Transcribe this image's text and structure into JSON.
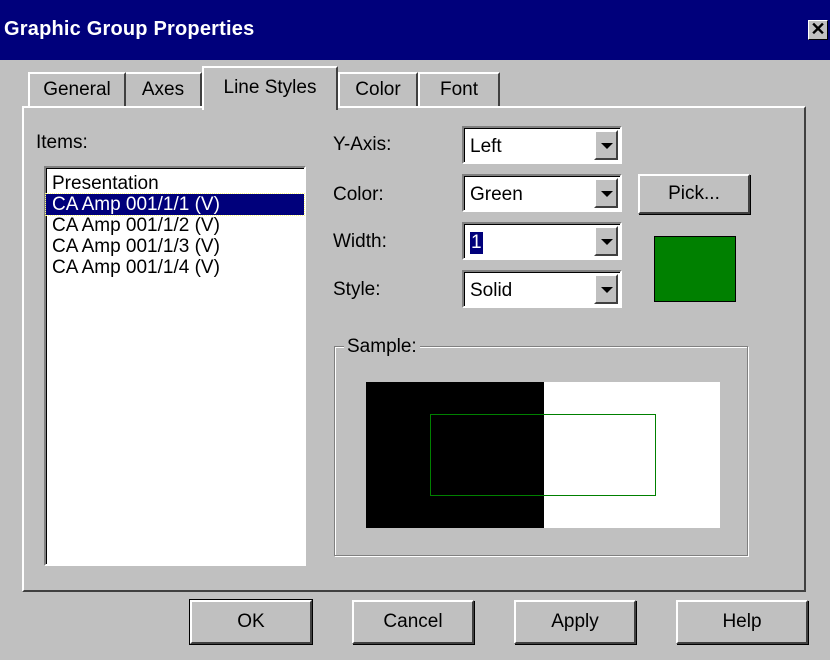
{
  "window": {
    "title": "Graphic Group Properties",
    "close_glyph": "✕"
  },
  "tabs": [
    {
      "label": "General"
    },
    {
      "label": "Axes"
    },
    {
      "label": "Line Styles"
    },
    {
      "label": "Color"
    },
    {
      "label": "Font"
    }
  ],
  "active_tab": "Line Styles",
  "items": {
    "label": "Items:",
    "list": [
      "Presentation",
      "CA Amp 001/1/1 (V)",
      "CA Amp 001/1/2 (V)",
      "CA Amp 001/1/3 (V)",
      "CA Amp 001/1/4 (V)"
    ],
    "selected_index": 1
  },
  "fields": {
    "y_axis": {
      "label": "Y-Axis:",
      "value": "Left"
    },
    "color": {
      "label": "Color:",
      "value": "Green"
    },
    "width": {
      "label": "Width:",
      "value": "1"
    },
    "style": {
      "label": "Style:",
      "value": "Solid"
    }
  },
  "pick_button": "Pick...",
  "swatch_color": "#008000",
  "sample": {
    "label": "Sample:",
    "line_color": "#008000"
  },
  "buttons": {
    "ok": "OK",
    "cancel": "Cancel",
    "apply": "Apply",
    "help": "Help"
  },
  "colors": {
    "titlebar": "#00007b",
    "face": "#c0c0c0"
  },
  "icons": {
    "close": "close-icon",
    "dropdown": "chevron-down-icon"
  }
}
